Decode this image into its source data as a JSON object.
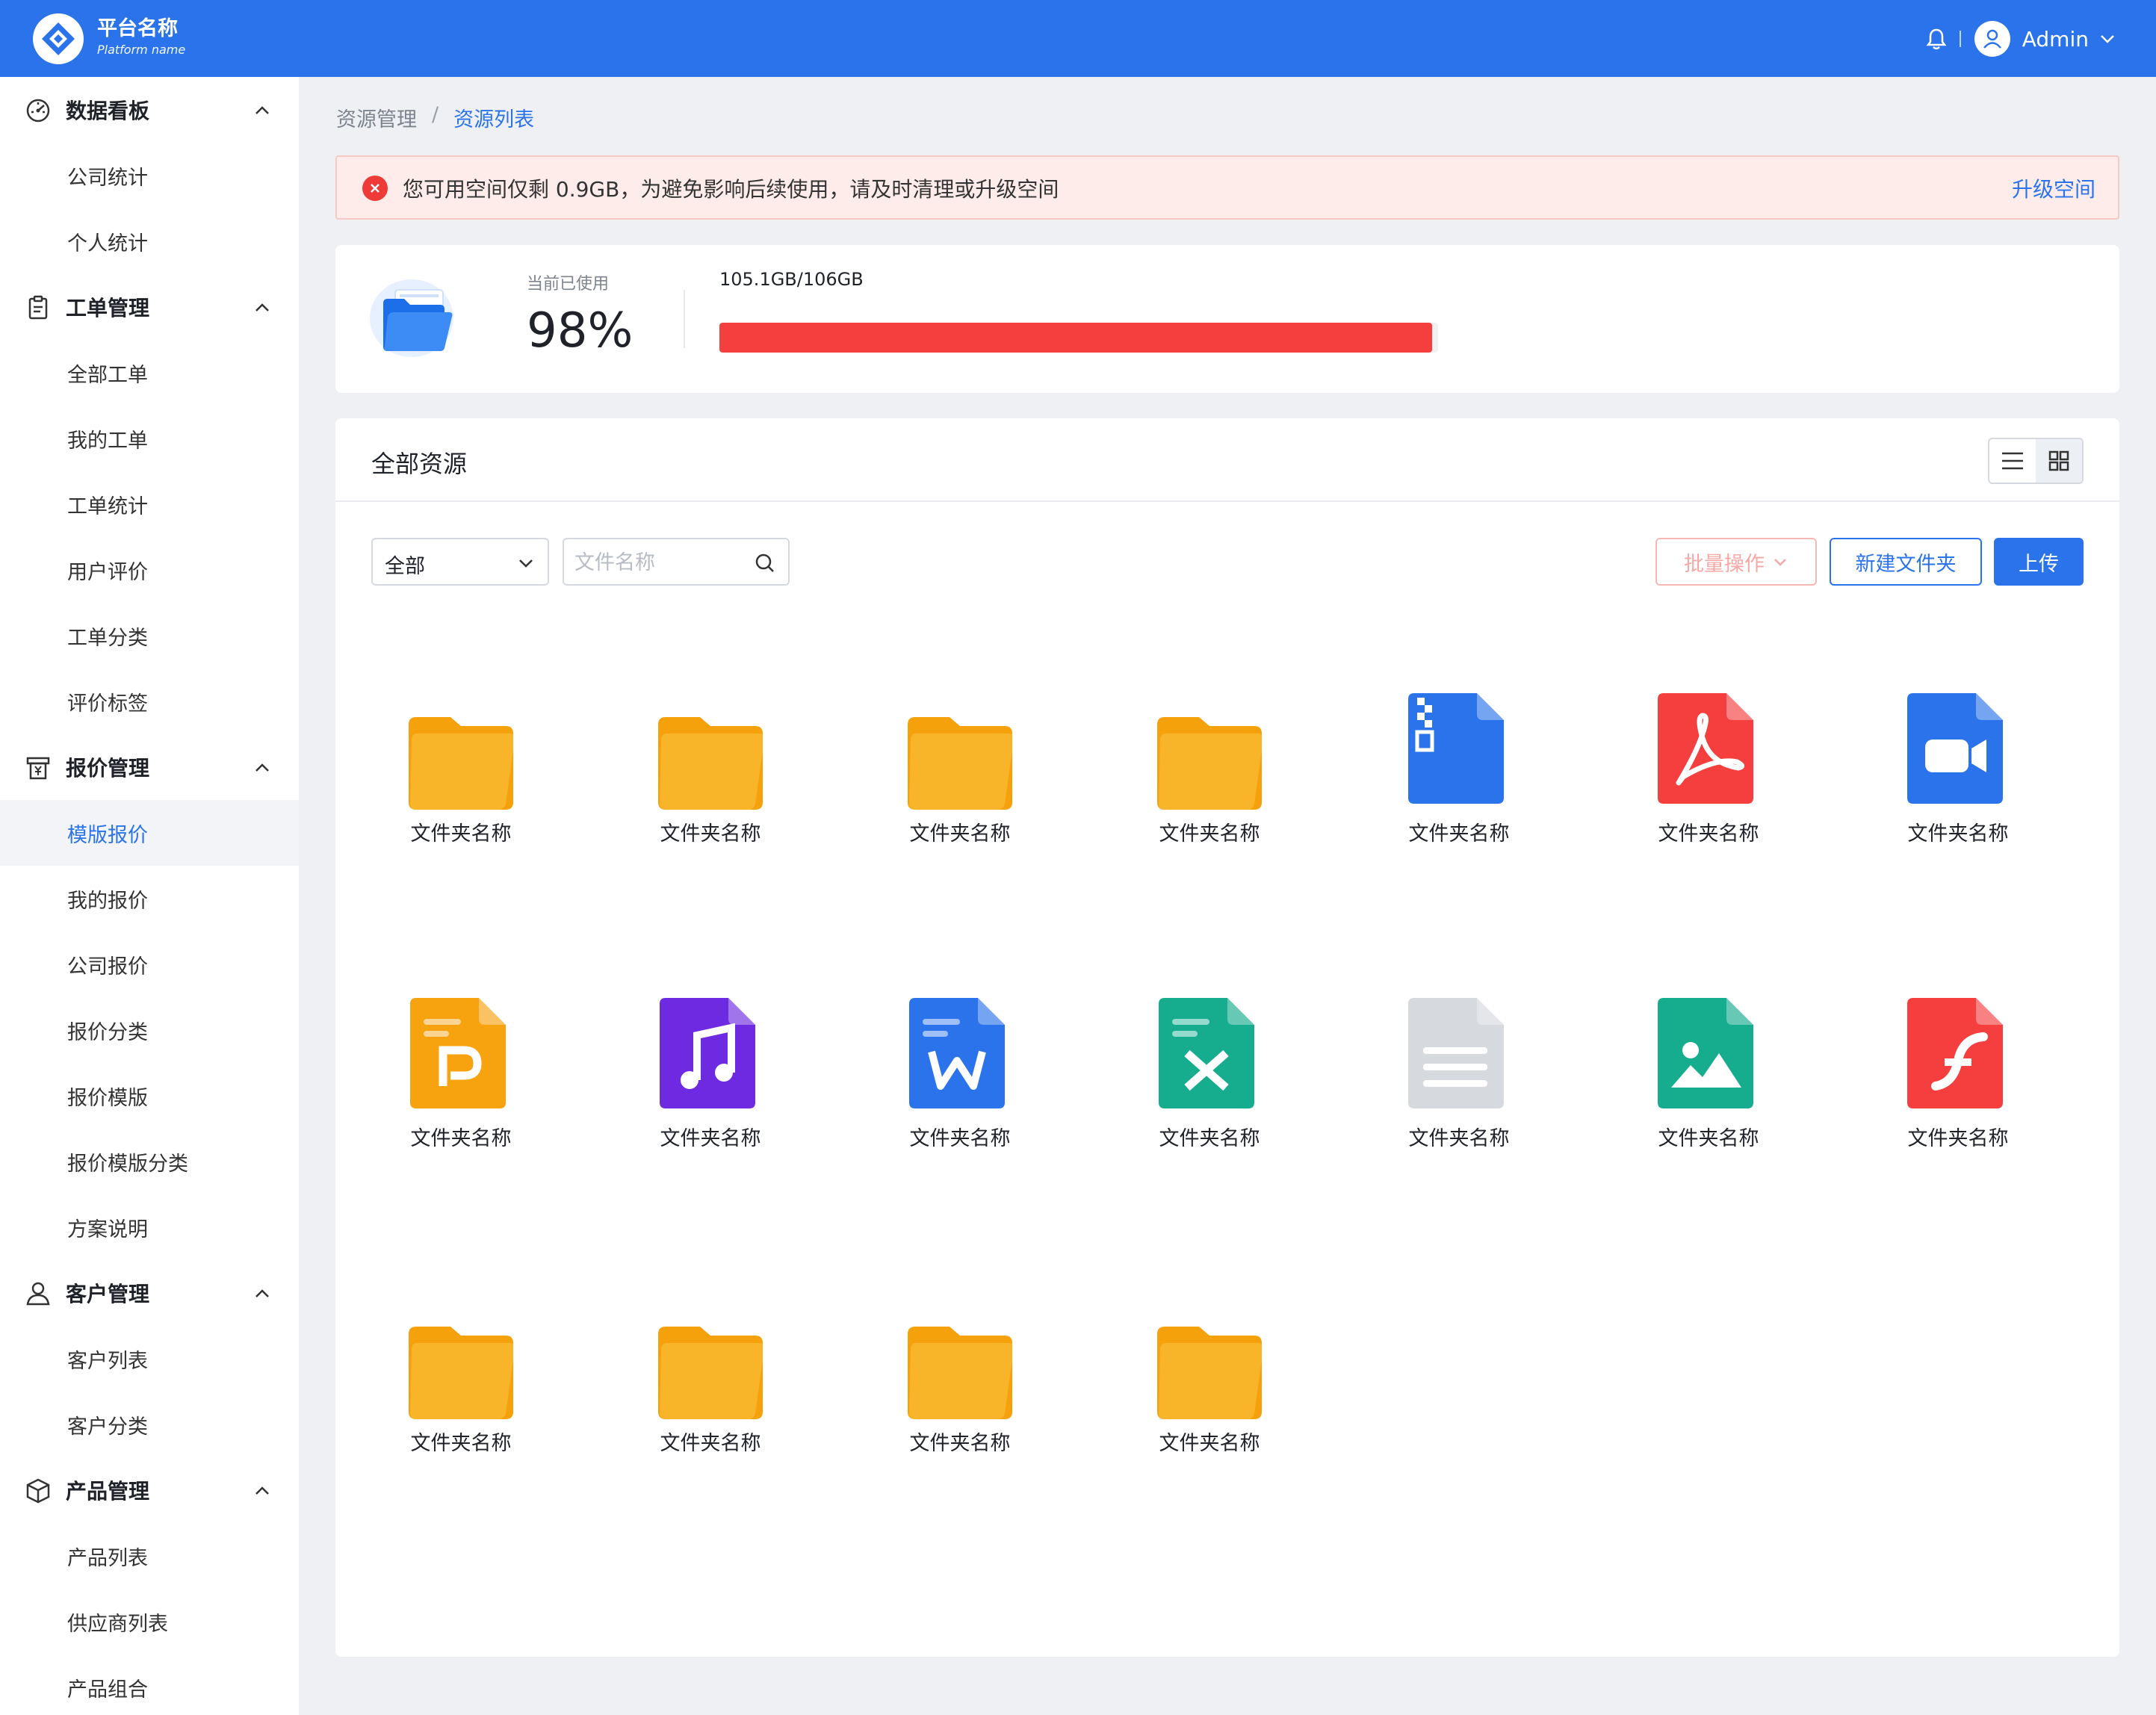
{
  "app": {
    "name": "平台名称",
    "subtitle": "Platform name",
    "user": "Admin"
  },
  "sidebar": {
    "groups": [
      {
        "label": "数据看板",
        "icon": "dashboard-icon",
        "items": [
          "公司统计",
          "个人统计"
        ]
      },
      {
        "label": "工单管理",
        "icon": "clipboard-icon",
        "items": [
          "全部工单",
          "我的工单",
          "工单统计",
          "用户评价",
          "工单分类",
          "评价标签"
        ]
      },
      {
        "label": "报价管理",
        "icon": "quote-icon",
        "items": [
          "模版报价",
          "我的报价",
          "公司报价",
          "报价分类",
          "报价模版",
          "报价模版分类",
          "方案说明"
        ]
      },
      {
        "label": "客户管理",
        "icon": "user-icon",
        "items": [
          "客户列表",
          "客户分类"
        ]
      },
      {
        "label": "产品管理",
        "icon": "box-icon",
        "items": [
          "产品列表",
          "供应商列表",
          "产品组合"
        ]
      }
    ],
    "active_item": "模版报价"
  },
  "breadcrumb": {
    "parent": "资源管理",
    "separator": "/",
    "current": "资源列表"
  },
  "alert": {
    "message": "您可用空间仅剩 0.9GB，为避免影响后续使用，请及时清理或升级空间",
    "action": "升级空间"
  },
  "storage": {
    "label": "当前已使用",
    "percent_text": "98%",
    "quota": "105.1GB/106GB",
    "used_fraction": 0.9915
  },
  "colors": {
    "primary": "#2b73ea",
    "danger": "#f53e3e",
    "folder": "#f7b125"
  },
  "resources": {
    "title": "全部资源",
    "filter_value": "全部",
    "search_placeholder": "文件名称",
    "batch_label": "批量操作",
    "new_folder_label": "新建文件夹",
    "upload_label": "上传",
    "items": [
      {
        "type": "folder",
        "name": "文件夹名称"
      },
      {
        "type": "folder",
        "name": "文件夹名称"
      },
      {
        "type": "folder",
        "name": "文件夹名称"
      },
      {
        "type": "folder",
        "name": "文件夹名称"
      },
      {
        "type": "zip",
        "name": "文件夹名称"
      },
      {
        "type": "pdf",
        "name": "文件夹名称"
      },
      {
        "type": "video",
        "name": "文件夹名称"
      },
      {
        "type": "ppt",
        "name": "文件夹名称"
      },
      {
        "type": "audio",
        "name": "文件夹名称"
      },
      {
        "type": "word",
        "name": "文件夹名称"
      },
      {
        "type": "excel",
        "name": "文件夹名称"
      },
      {
        "type": "text",
        "name": "文件夹名称"
      },
      {
        "type": "image",
        "name": "文件夹名称"
      },
      {
        "type": "flash",
        "name": "文件夹名称"
      },
      {
        "type": "folder",
        "name": "文件夹名称"
      },
      {
        "type": "folder",
        "name": "文件夹名称"
      },
      {
        "type": "folder",
        "name": "文件夹名称"
      },
      {
        "type": "folder",
        "name": "文件夹名称"
      }
    ]
  }
}
